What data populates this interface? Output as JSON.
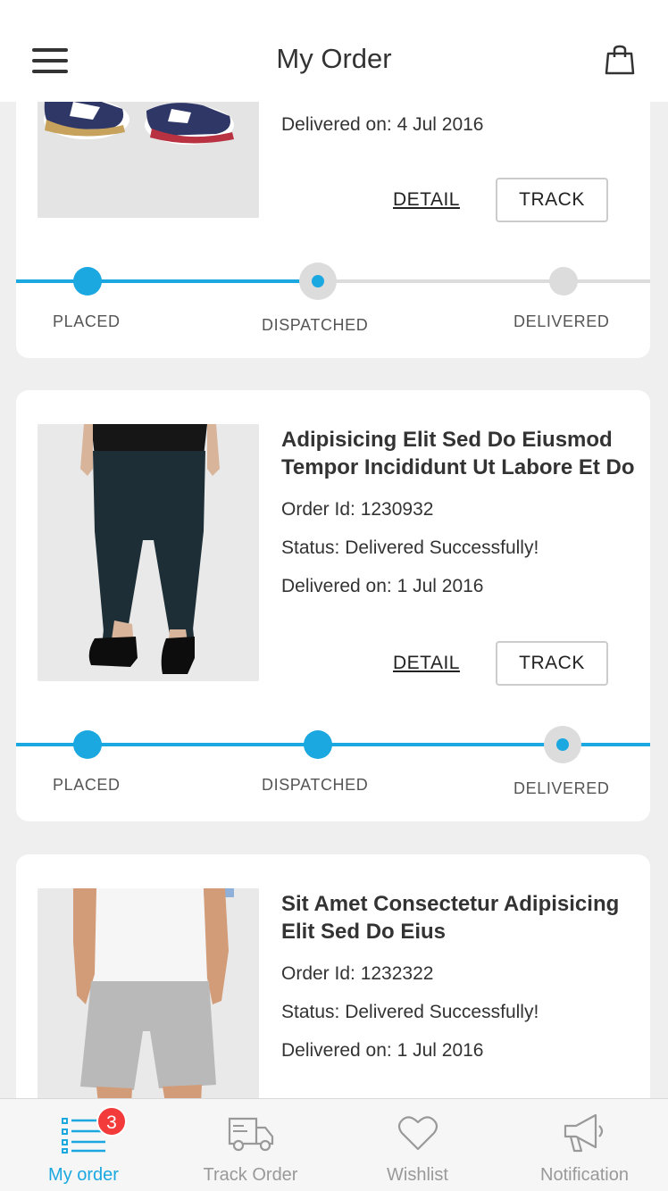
{
  "header": {
    "title": "My Order",
    "menu_icon": "hamburger-menu-icon",
    "cart_icon": "shopping-bag-icon"
  },
  "orders": [
    {
      "image": "sneakers-photo",
      "delivered": "Delivered on: 4 Jul 2016",
      "detail_label": "DETAIL",
      "track_label": "TRACK",
      "steps": [
        "PLACED",
        "DISPATCHED",
        "DELIVERED"
      ],
      "current_step": 2
    },
    {
      "image": "jeans-photo",
      "name": "Adipisicing Elit Sed Do Eiusmod Tempor Incididunt Ut Labore Et Do",
      "order_id": "Order Id: 1230932",
      "status": "Status: Delivered Successfully!",
      "delivered": "Delivered on: 1 Jul 2016",
      "detail_label": "DETAIL",
      "track_label": "TRACK",
      "steps": [
        "PLACED",
        "DISPATCHED",
        "DELIVERED"
      ],
      "current_step": 3
    },
    {
      "image": "shorts-photo",
      "name": "Sit Amet Consectetur Adipisicing Elit Sed Do Eius",
      "order_id": "Order Id: 1232322",
      "status": "Status: Delivered Successfully!",
      "delivered": "Delivered on: 1 Jul 2016"
    }
  ],
  "tabbar": {
    "tabs": [
      {
        "label": "My order",
        "icon": "order-list-icon",
        "badge": "3"
      },
      {
        "label": "Track Order",
        "icon": "truck-icon"
      },
      {
        "label": "Wishlist",
        "icon": "heart-icon"
      },
      {
        "label": "Notification",
        "icon": "megaphone-icon"
      }
    ]
  },
  "colors": {
    "accent": "#1ba8e0",
    "inactive": "#dcdcdc",
    "badge": "#f33b3b",
    "background": "#efefef"
  }
}
